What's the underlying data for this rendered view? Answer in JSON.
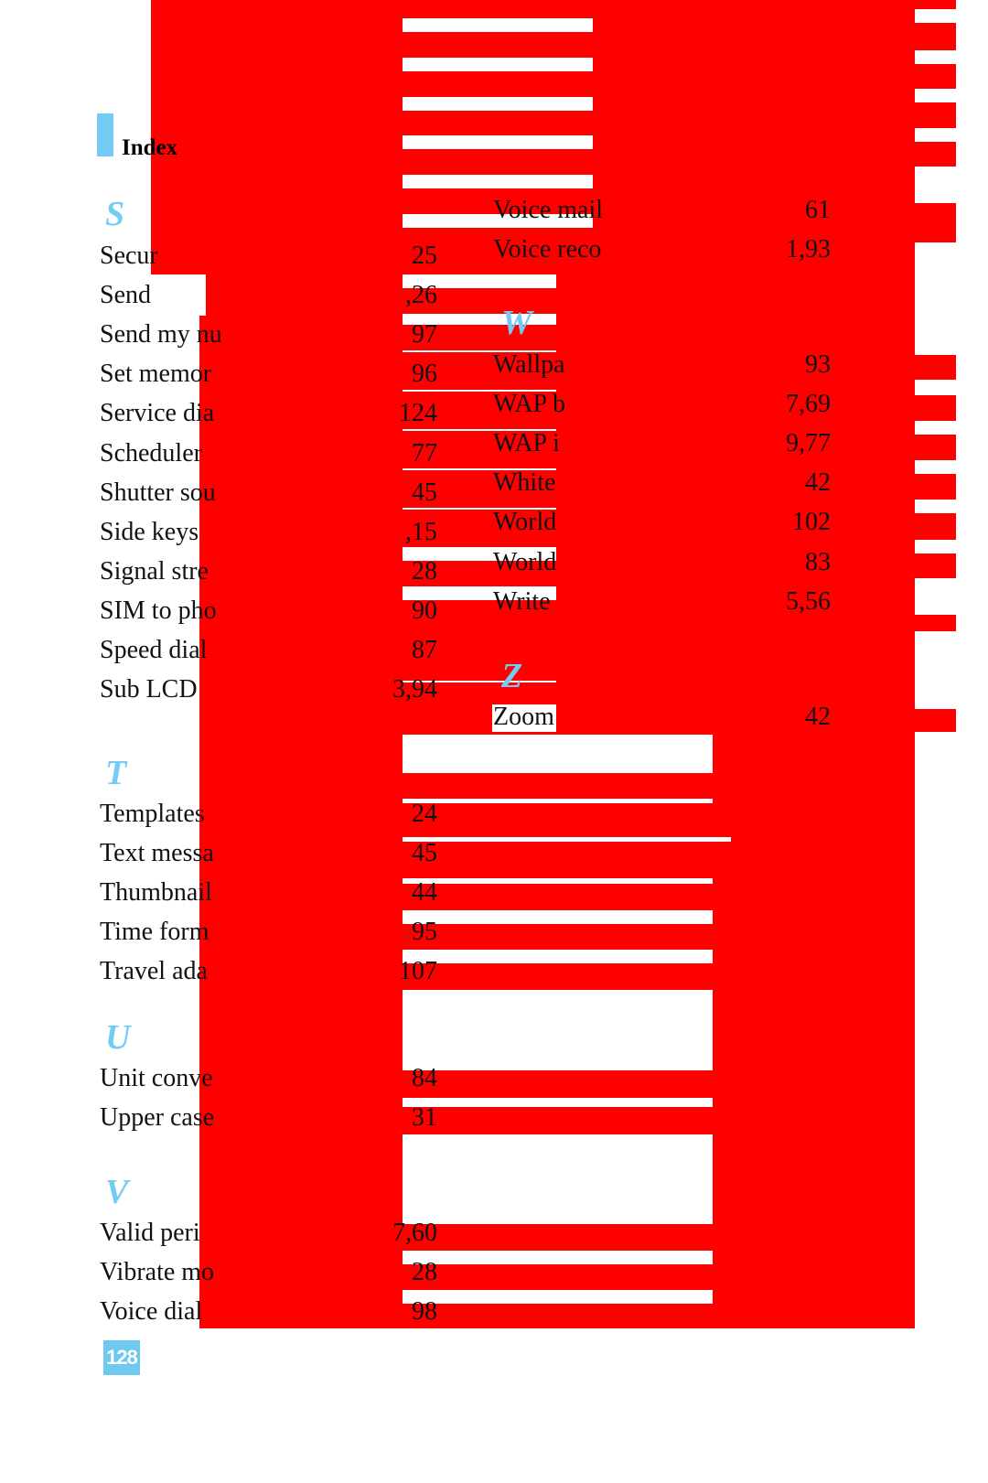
{
  "header": {
    "title": "Index"
  },
  "colors": {
    "accent": "#74ccf4",
    "redaction": "#ff0000"
  },
  "left_column": [
    {
      "letter": "S",
      "entries": [
        {
          "term": "Secur",
          "page": "25"
        },
        {
          "term": "Send",
          "page": ",26"
        },
        {
          "term": "Send my nu",
          "page": "97"
        },
        {
          "term": "Set memor",
          "page": "96"
        },
        {
          "term": "Service dia",
          "page": "124"
        },
        {
          "term": "Scheduler",
          "page": "77"
        },
        {
          "term": "Shutter sou",
          "page": "45"
        },
        {
          "term": "Side keys",
          "page": ",15"
        },
        {
          "term": "Signal stre",
          "page": "28"
        },
        {
          "term": "SIM to pho",
          "page": "90"
        },
        {
          "term": "Speed dial",
          "page": "87"
        },
        {
          "term": "Sub LCD",
          "page": "3,94"
        }
      ]
    },
    {
      "letter": "T",
      "entries": [
        {
          "term": "Templates",
          "page": "24"
        },
        {
          "term": "Text messa",
          "page": "45"
        },
        {
          "term": "Thumbnail",
          "page": "44"
        },
        {
          "term": "Time form",
          "page": "95"
        },
        {
          "term": "Travel ada",
          "page": "107"
        }
      ]
    },
    {
      "letter": "U",
      "entries": [
        {
          "term": "Unit conve",
          "page": "84"
        },
        {
          "term": "Upper case",
          "page": "31"
        }
      ]
    },
    {
      "letter": "V",
      "entries": [
        {
          "term": "Valid peri",
          "page": "7,60"
        },
        {
          "term": "Vibrate mo",
          "page": "28"
        },
        {
          "term": "Voice dial",
          "page": "98"
        }
      ]
    }
  ],
  "right_column": [
    {
      "letter": "",
      "entries": [
        {
          "term": "Voice mail",
          "page": "61"
        },
        {
          "term": "Voice reco",
          "page": "1,93"
        }
      ]
    },
    {
      "letter": "W",
      "entries": [
        {
          "term": "Wallpa",
          "page": "93"
        },
        {
          "term": "WAP b",
          "page": "7,69"
        },
        {
          "term": "WAP i",
          "page": "9,77"
        },
        {
          "term": "White",
          "page": "42"
        },
        {
          "term": "World",
          "page": "102"
        },
        {
          "term": "World",
          "page": "83"
        },
        {
          "term": "Write",
          "page": "5,56"
        }
      ]
    },
    {
      "letter": "Z",
      "entries": [
        {
          "term": "Zoom",
          "page": "42"
        }
      ]
    }
  ],
  "footer": {
    "page_number": "128"
  }
}
